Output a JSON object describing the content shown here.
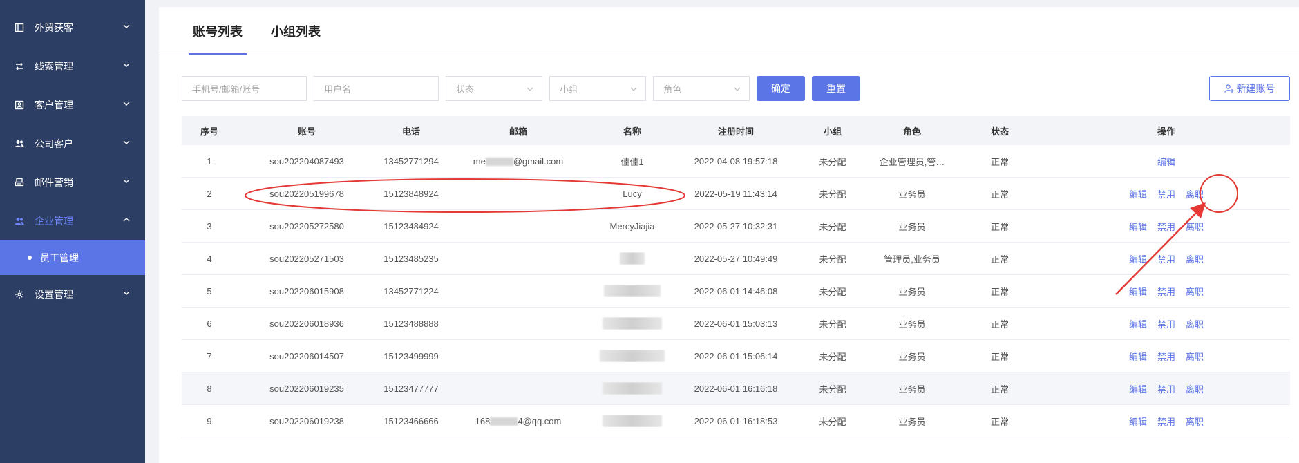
{
  "sidebar": {
    "items": [
      {
        "label": "外贸获客"
      },
      {
        "label": "线索管理"
      },
      {
        "label": "客户管理"
      },
      {
        "label": "公司客户"
      },
      {
        "label": "邮件营销"
      },
      {
        "label": "企业管理"
      },
      {
        "label": "设置管理"
      }
    ],
    "active_index": 5,
    "sub_item": "员工管理"
  },
  "tabs": [
    {
      "label": "账号列表",
      "active": true
    },
    {
      "label": "小组列表",
      "active": false
    }
  ],
  "filters": {
    "phone_placeholder": "手机号/邮箱/账号",
    "username_placeholder": "用户名",
    "status_placeholder": "状态",
    "group_placeholder": "小组",
    "role_placeholder": "角色",
    "confirm_label": "确定",
    "reset_label": "重置",
    "new_account_label": "新建账号"
  },
  "table": {
    "columns": [
      "序号",
      "账号",
      "电话",
      "邮箱",
      "名称",
      "注册时间",
      "小组",
      "角色",
      "状态",
      "操作"
    ],
    "ops": {
      "edit": "编辑",
      "disable": "禁用",
      "resign": "离职"
    },
    "rows": [
      {
        "no": "1",
        "account": "sou202204087493",
        "phone": "13452771294",
        "email_prefix": "me",
        "email_suffix": "@gmail.com",
        "name": "佳佳1",
        "time": "2022-04-08 19:57:18",
        "group": "未分配",
        "role": "企业管理员,管…",
        "status": "正常"
      },
      {
        "no": "2",
        "account": "sou202205199678",
        "phone": "15123848924",
        "email_prefix": "",
        "email_suffix": "",
        "name": "Lucy",
        "time": "2022-05-19 11:43:14",
        "group": "未分配",
        "role": "业务员",
        "status": "正常"
      },
      {
        "no": "3",
        "account": "sou202205272580",
        "phone": "15123484924",
        "email_prefix": "",
        "email_suffix": "",
        "name": "MercyJiajia",
        "time": "2022-05-27 10:32:31",
        "group": "未分配",
        "role": "业务员",
        "status": "正常"
      },
      {
        "no": "4",
        "account": "sou202205271503",
        "phone": "15123485235",
        "email_prefix": "",
        "email_suffix": "",
        "name": "",
        "time": "2022-05-27 10:49:49",
        "group": "未分配",
        "role": "管理员,业务员",
        "status": "正常"
      },
      {
        "no": "5",
        "account": "sou202206015908",
        "phone": "13452771224",
        "email_prefix": "",
        "email_suffix": "",
        "name": "",
        "time": "2022-06-01 14:46:08",
        "group": "未分配",
        "role": "业务员",
        "status": "正常"
      },
      {
        "no": "6",
        "account": "sou202206018936",
        "phone": "15123488888",
        "email_prefix": "",
        "email_suffix": "",
        "name": "",
        "time": "2022-06-01 15:03:13",
        "group": "未分配",
        "role": "业务员",
        "status": "正常"
      },
      {
        "no": "7",
        "account": "sou202206014507",
        "phone": "15123499999",
        "email_prefix": "",
        "email_suffix": "",
        "name": "",
        "time": "2022-06-01 15:06:14",
        "group": "未分配",
        "role": "业务员",
        "status": "正常"
      },
      {
        "no": "8",
        "account": "sou202206019235",
        "phone": "15123477777",
        "email_prefix": "",
        "email_suffix": "",
        "name": "",
        "time": "2022-06-01 16:16:18",
        "group": "未分配",
        "role": "业务员",
        "status": "正常"
      },
      {
        "no": "9",
        "account": "sou202206019238",
        "phone": "15123466666",
        "email_prefix": "168",
        "email_suffix": "4@qq.com",
        "name": "",
        "time": "2022-06-01 16:18:53",
        "group": "未分配",
        "role": "业务员",
        "status": "正常"
      }
    ]
  },
  "colors": {
    "sidebar_bg": "#2c3e63",
    "accent": "#5b74e6",
    "annotation": "#e53935"
  }
}
